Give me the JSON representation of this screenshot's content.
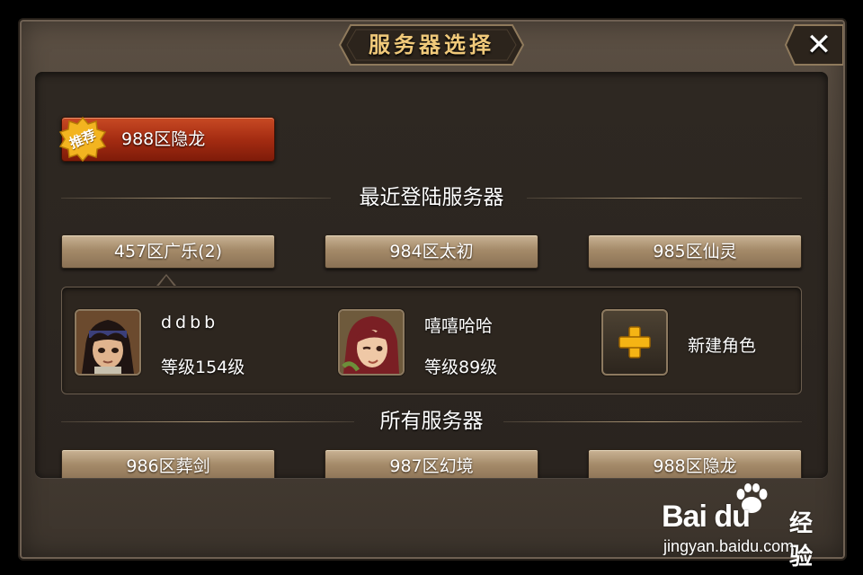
{
  "dialog": {
    "title": "服务器选择",
    "close_label": "✕"
  },
  "recommended": {
    "badge": "推荐",
    "server_label": "988区隐龙"
  },
  "recent": {
    "heading": "最近登陆服务器",
    "servers": [
      "457区广乐(2)",
      "984区太初",
      "985区仙灵"
    ]
  },
  "characters": [
    {
      "name": "ddbb",
      "level": "等级154级",
      "avatar_icon": "male-warrior-avatar-icon"
    },
    {
      "name": "嘻嘻哈哈",
      "level": "等级89级",
      "avatar_icon": "female-elf-avatar-icon"
    }
  ],
  "new_character": {
    "label": "新建角色",
    "icon": "plus-icon"
  },
  "all": {
    "heading": "所有服务器",
    "servers": [
      "986区葬剑",
      "987区幻境",
      "988区隐龙"
    ]
  },
  "watermark": {
    "logo": "Bai du",
    "sub": "经验",
    "url": "jingyan.baidu.com"
  },
  "colors": {
    "recommended_red": "#a52c12",
    "server_button_tan": "#a48a69",
    "title_gold": "#f0c97a"
  }
}
